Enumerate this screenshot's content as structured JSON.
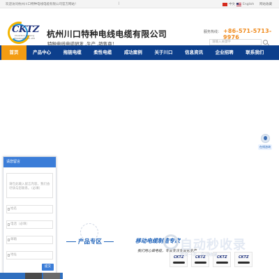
{
  "topbar": {
    "welcome": "欢迎访问杭州川口特种电线电缆有限公司官方网站！",
    "separator": "|",
    "lang_cn": "中文",
    "lang_en": "English",
    "favorite": "网站收藏"
  },
  "header": {
    "logo_text": "CKTZ",
    "logo_sub": "Chuankou Tezhong Wire&Cable CO.,LTD",
    "company_name": "杭州川口特种电线电缆有限公司",
    "slogan": "特种电线电缆研发 ,生产 ,销售商！",
    "hotline_label": "服务热线：",
    "hotline": "+86-571-5713-9976",
    "search_placeholder": "请输入关键字"
  },
  "nav": {
    "items": [
      "首页",
      "产品中心",
      "拖链电缆",
      "柔性电缆",
      "成功案例",
      "关于川口",
      "信息资讯",
      "企业招聘",
      "联系我们"
    ]
  },
  "float_service": {
    "label": "在线咨询"
  },
  "message_panel": {
    "title": "请您留言",
    "content_placeholder": "请在此输入留言内容，我们会尽快与您联系。（必填）",
    "name_placeholder": "姓名",
    "phone_placeholder": "电话（必填）",
    "email_placeholder": "邮箱",
    "address_placeholder": "地址",
    "submit": "提交"
  },
  "products": {
    "title": "产品专区",
    "subtitle": "移动电缆制造专家",
    "description": "我们用心做电缆，专业专注专业化生产",
    "thumb_logo": "CKTZ"
  },
  "stamp": {
    "big": "自动秒收录",
    "small": "提交一次 · 自动收录"
  },
  "colors": {
    "nav_bg": "#0c3f8c",
    "nav_active": "#f39c12",
    "accent_blue": "#1e62b9",
    "hotline": "#f08a1c"
  }
}
